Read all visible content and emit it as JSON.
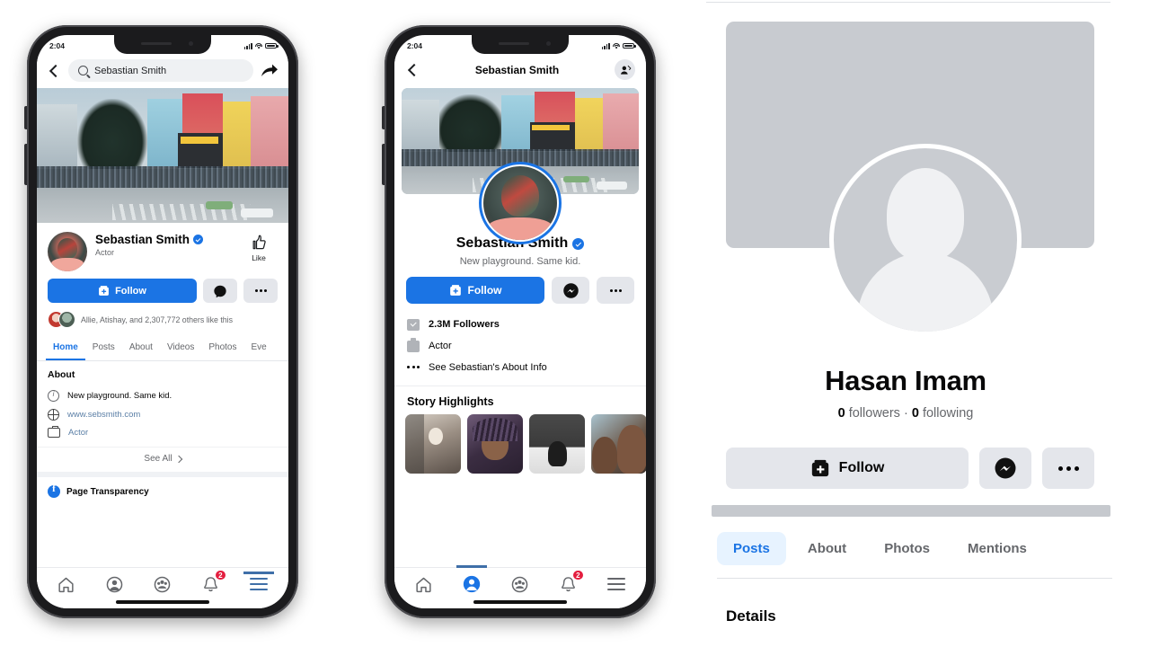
{
  "phone1": {
    "status": {
      "time": "2:04"
    },
    "nav": {
      "search_value": "Sebastian Smith",
      "back": "Back",
      "share": "Share"
    },
    "profile": {
      "name": "Sebastian Smith",
      "category": "Actor",
      "like_label": "Like",
      "follow_label": "Follow",
      "likers_text": "Allie, Atishay, and 2,307,772 others like this"
    },
    "tabs": [
      "Home",
      "Posts",
      "About",
      "Videos",
      "Photos",
      "Eve"
    ],
    "active_tab": "Home",
    "about": {
      "heading": "About",
      "bio": "New playground. Same kid.",
      "website": "www.sebsmith.com",
      "category": "Actor",
      "see_all": "See All"
    },
    "transparency": "Page Transparency",
    "bottom_nav": {
      "items": [
        "home-icon",
        "profile-icon",
        "groups-icon",
        "notifications-icon",
        "menu-icon"
      ],
      "notification_badge": "2",
      "active": "menu-icon"
    }
  },
  "phone2": {
    "status": {
      "time": "2:04"
    },
    "nav": {
      "title": "Sebastian Smith"
    },
    "profile": {
      "name": "Sebastian Smith",
      "bio": "New playground. Same kid.",
      "follow_label": "Follow"
    },
    "info_rows": [
      {
        "icon": "flag-icon",
        "text": "2.3M Followers",
        "bold": true
      },
      {
        "icon": "briefcase-icon",
        "text": "Actor",
        "bold": false
      },
      {
        "icon": "dots-icon",
        "text": "See Sebastian's About Info",
        "bold": false
      }
    ],
    "story_highlights_title": "Story Highlights",
    "stories": [
      "story-1",
      "story-2",
      "story-3",
      "story-4"
    ],
    "bottom_nav": {
      "items": [
        "home-icon",
        "profile-icon",
        "groups-icon",
        "notifications-icon",
        "menu-icon"
      ],
      "notification_badge": "2",
      "active": "profile-icon"
    }
  },
  "desktop": {
    "name": "Hasan Imam",
    "followers_count": "0",
    "followers_label": "followers",
    "separator": "·",
    "following_count": "0",
    "following_label": "following",
    "follow_label": "Follow",
    "tabs": [
      "Posts",
      "About",
      "Photos",
      "Mentions"
    ],
    "active_tab": "Posts",
    "details_heading": "Details"
  },
  "colors": {
    "facebook_blue": "#1b74e4",
    "light_blue_tab": "#e7f3ff",
    "grey_button": "#e4e6eb",
    "placeholder_grey": "#c8cbd0",
    "badge_red": "#e41e3f",
    "secondary_text": "#65676b"
  }
}
